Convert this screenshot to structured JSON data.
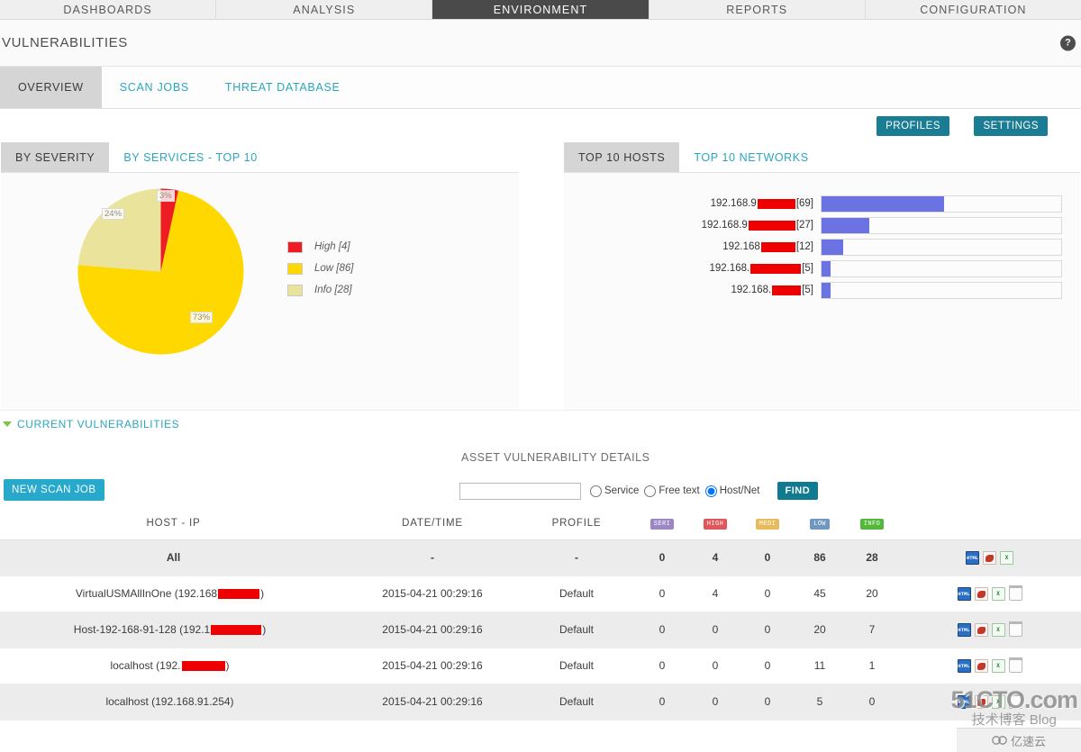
{
  "topnav": {
    "items": [
      {
        "label": "DASHBOARDS",
        "active": false
      },
      {
        "label": "ANALYSIS",
        "active": false
      },
      {
        "label": "ENVIRONMENT",
        "active": true
      },
      {
        "label": "REPORTS",
        "active": false
      },
      {
        "label": "CONFIGURATION",
        "active": false
      }
    ]
  },
  "header": {
    "title": "VULNERABILITIES",
    "help_icon": "help-icon",
    "help_glyph": "?"
  },
  "subtabs": [
    {
      "label": "OVERVIEW",
      "active": true
    },
    {
      "label": "SCAN JOBS",
      "active": false
    },
    {
      "label": "THREAT DATABASE",
      "active": false
    }
  ],
  "toolbar": {
    "profiles_label": "PROFILES",
    "settings_label": "SETTINGS",
    "accent_teal": "#1b7d94"
  },
  "left_panel": {
    "tabs": [
      {
        "label": "BY SEVERITY",
        "active": true
      },
      {
        "label": "BY SERVICES - TOP 10",
        "active": false
      }
    ]
  },
  "right_panel": {
    "tabs": [
      {
        "label": "TOP 10 HOSTS",
        "active": true
      },
      {
        "label": "TOP 10 NETWORKS",
        "active": false
      }
    ]
  },
  "current_vulnerabilities": {
    "label": "CURRENT VULNERABILITIES",
    "caret": "caret-down-icon"
  },
  "new_scan": {
    "label": "NEW SCAN JOB",
    "color": "#27a9cb"
  },
  "search": {
    "section_title": "ASSET VULNERABILITY DETAILS",
    "input_value": "",
    "placeholder": "",
    "options": [
      {
        "label": "Service",
        "selected": false
      },
      {
        "label": "Free text",
        "selected": false
      },
      {
        "label": "Host/Net",
        "selected": true
      }
    ],
    "find_label": "FIND"
  },
  "table": {
    "headers": [
      "HOST - IP",
      "DATE/TIME",
      "PROFILE",
      "SERI",
      "HIGH",
      "MEDI",
      "LOW",
      "INFO",
      ""
    ],
    "severity_badges": [
      {
        "text": "SERI",
        "color": "#9b87c4"
      },
      {
        "text": "HIGH",
        "color": "#e0565a"
      },
      {
        "text": "MEDI",
        "color": "#e8bb5a"
      },
      {
        "text": "LOW",
        "color": "#6f97bf"
      },
      {
        "text": "INFO",
        "color": "#53b83a"
      }
    ],
    "rows": [
      {
        "host": "All",
        "host_redacted": false,
        "redact_width": 0,
        "datetime": "-",
        "profile": "-",
        "seri": "0",
        "high": "4",
        "medi": "0",
        "low": "86",
        "info": "28",
        "actions": [
          "HTML",
          "PDF",
          "XLS"
        ],
        "highlight": true
      },
      {
        "host": "VirtualUSMAllInOne (192.168",
        "host_suffix": ")",
        "host_redacted": true,
        "redact_width": 46,
        "datetime": "2015-04-21 00:29:16",
        "profile": "Default",
        "seri": "0",
        "high": "4",
        "medi": "0",
        "low": "45",
        "info": "20",
        "actions": [
          "HTML",
          "PDF",
          "XLS",
          "TRASH"
        ],
        "highlight": false
      },
      {
        "host": "Host-192-168-91-128 (192.1",
        "host_suffix": ")",
        "host_redacted": true,
        "redact_width": 56,
        "datetime": "2015-04-21 00:29:16",
        "profile": "Default",
        "seri": "0",
        "high": "0",
        "medi": "0",
        "low": "20",
        "info": "7",
        "actions": [
          "HTML",
          "PDF",
          "XLS",
          "TRASH"
        ],
        "highlight": true
      },
      {
        "host": "localhost (192.",
        "host_suffix": ")",
        "host_redacted": true,
        "redact_width": 48,
        "datetime": "2015-04-21 00:29:16",
        "profile": "Default",
        "seri": "0",
        "high": "0",
        "medi": "0",
        "low": "11",
        "info": "1",
        "actions": [
          "HTML",
          "PDF",
          "XLS",
          "TRASH"
        ],
        "highlight": false
      },
      {
        "host": "localhost (192.168.91.254)",
        "host_suffix": "",
        "host_redacted": false,
        "redact_width": 0,
        "datetime": "2015-04-21 00:29:16",
        "profile": "Default",
        "seri": "0",
        "high": "0",
        "medi": "0",
        "low": "5",
        "info": "0",
        "actions": [
          "HTML",
          "PDF",
          "XLS",
          "TRASH"
        ],
        "highlight": true
      }
    ]
  },
  "watermark": {
    "line1": "51CTO.com",
    "line2": "技术博客 Blog",
    "badge": "亿速云"
  },
  "chart_data": [
    {
      "type": "pie",
      "title": "BY SEVERITY",
      "categories": [
        "High",
        "Low",
        "Info"
      ],
      "values": [
        4,
        86,
        28
      ],
      "percent_labels": [
        "3%",
        "73%",
        "24%"
      ],
      "legend_labels": [
        "High [4]",
        "Low [86]",
        "Info [28]"
      ],
      "colors": [
        "#ee1c23",
        "#ffd800",
        "#e9e39c"
      ],
      "legend_position": "right"
    },
    {
      "type": "bar",
      "title": "TOP 10 HOSTS",
      "orientation": "horizontal",
      "categories": [
        "192.168.9████ [69]",
        "192.168.9████ [27]",
        "192.168███ [12]",
        "192.168.███ [5]",
        "192.168.██ [5]"
      ],
      "label_prefixes": [
        "192.168.9",
        "192.168.9",
        "192.168",
        "192.168.",
        "192.168."
      ],
      "label_suffixes": [
        "[69]",
        "[27]",
        "[12]",
        "[5]",
        "[5]"
      ],
      "redact_widths": [
        42,
        52,
        38,
        56,
        32
      ],
      "values": [
        69,
        27,
        12,
        5,
        5
      ],
      "xlim": [
        0,
        135
      ],
      "bar_color": "#6b72e2",
      "grid": false,
      "legend_position": "none"
    }
  ]
}
